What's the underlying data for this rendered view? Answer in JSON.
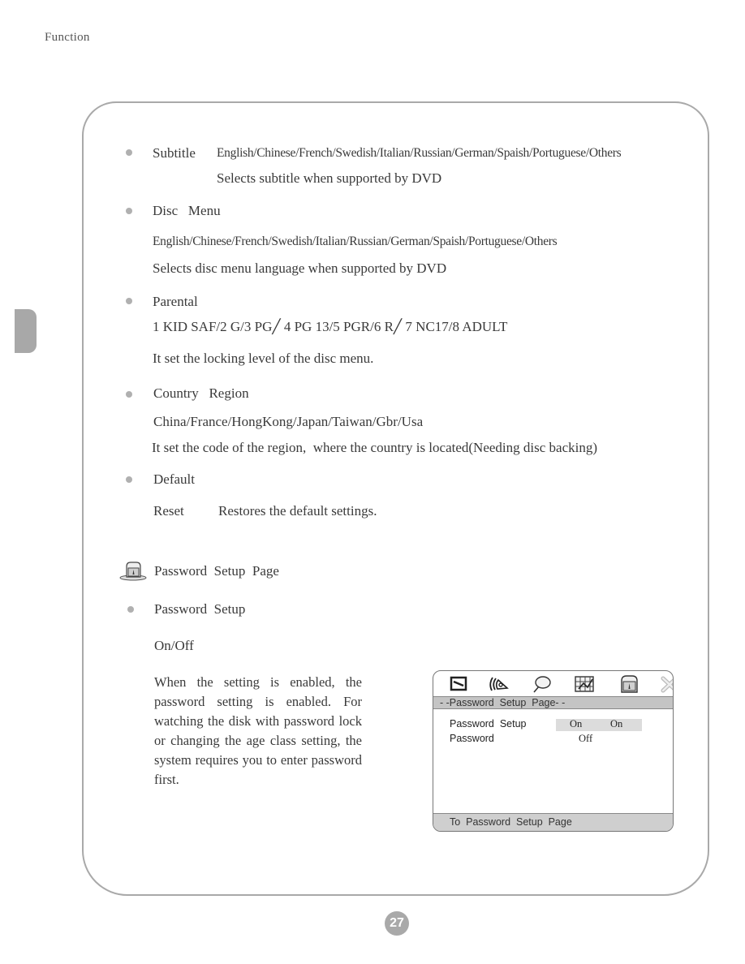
{
  "header": {
    "section_label": "Function"
  },
  "sections": {
    "subtitle": {
      "label": "Subtitle",
      "options": "English/Chinese/French/Swedish/Italian/Russian/German/Spaish/Portuguese/Others",
      "description": "Selects subtitle when supported by DVD"
    },
    "disc_menu": {
      "label": "Disc   Menu",
      "options": "English/Chinese/French/Swedish/Italian/Russian/German/Spaish/Portuguese/Others",
      "description": "Selects disc menu language when supported by DVD"
    },
    "parental": {
      "label": "Parental",
      "options": "1 KID SAF/2 G/3 PG╱ 4 PG 13/5 PGR/6 R╱ 7 NC17/8 ADULT",
      "description": "It set the locking level of the disc menu."
    },
    "country_region": {
      "label": "Country   Region",
      "options": "China/France/HongKong/Japan/Taiwan/Gbr/Usa",
      "description": "It set the code of the region,  where the country is located(Needing disc backing)"
    },
    "default": {
      "label": "Default",
      "reset_label": "Reset",
      "reset_description": "Restores the default settings."
    }
  },
  "password_page": {
    "heading": "Password  Setup  Page",
    "icon": "password-lock-icon",
    "setup": {
      "label": "Password  Setup",
      "options": "On/Off",
      "description": "When the setting is enabled, the password setting is enabled. For watching the disk with password lock or changing the age class setting, the system requires you to enter password first."
    }
  },
  "osd": {
    "icons": [
      "general-setup-icon",
      "audio-setup-icon",
      "dolby-setup-icon",
      "video-setup-icon",
      "password-setup-icon",
      "exit-icon"
    ],
    "title": "- -Password  Setup  Page- -",
    "rows": [
      {
        "label": "Password  Setup",
        "value": "On",
        "option": "On"
      },
      {
        "label": "Password",
        "value": "Off"
      }
    ],
    "footer": "To  Password  Setup  Page"
  },
  "footer": {
    "page_number": "27"
  }
}
